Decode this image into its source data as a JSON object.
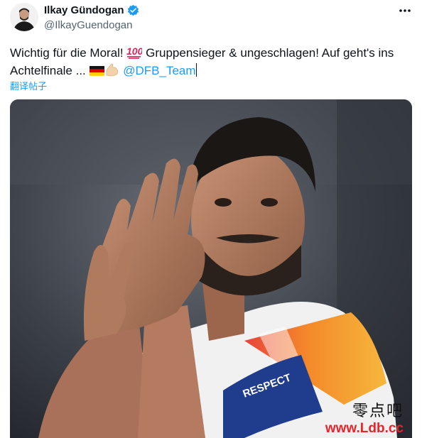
{
  "author": {
    "display_name": "Ilkay Gündogan",
    "handle": "@IlkayGuendogan",
    "avatar_icon": "profile-photo",
    "verified_icon": "verified-badge-icon"
  },
  "tweet": {
    "text_part1": "Wichtig für die Moral! ",
    "emoji_1": "hundred-points-emoji",
    "text_part2": " Gruppensieger & ungeschlagen! Auf geht's ins Achtelfinale  ... ",
    "emoji_2": "germany-flag-emoji",
    "emoji_3": "flexed-biceps-emoji",
    "mention": " @DFB_Team"
  },
  "translate_link": "翻译帖子",
  "photo": {
    "armband_text": "RESPECT",
    "description_icon": "player-applauding-photo"
  },
  "watermark": {
    "chinese": "零点吧",
    "url": "www.Ldb.cc"
  },
  "colors": {
    "link": "#1d9bf0",
    "text": "#0f1419",
    "secondary": "#536471",
    "watermark_red": "#e8242a"
  }
}
